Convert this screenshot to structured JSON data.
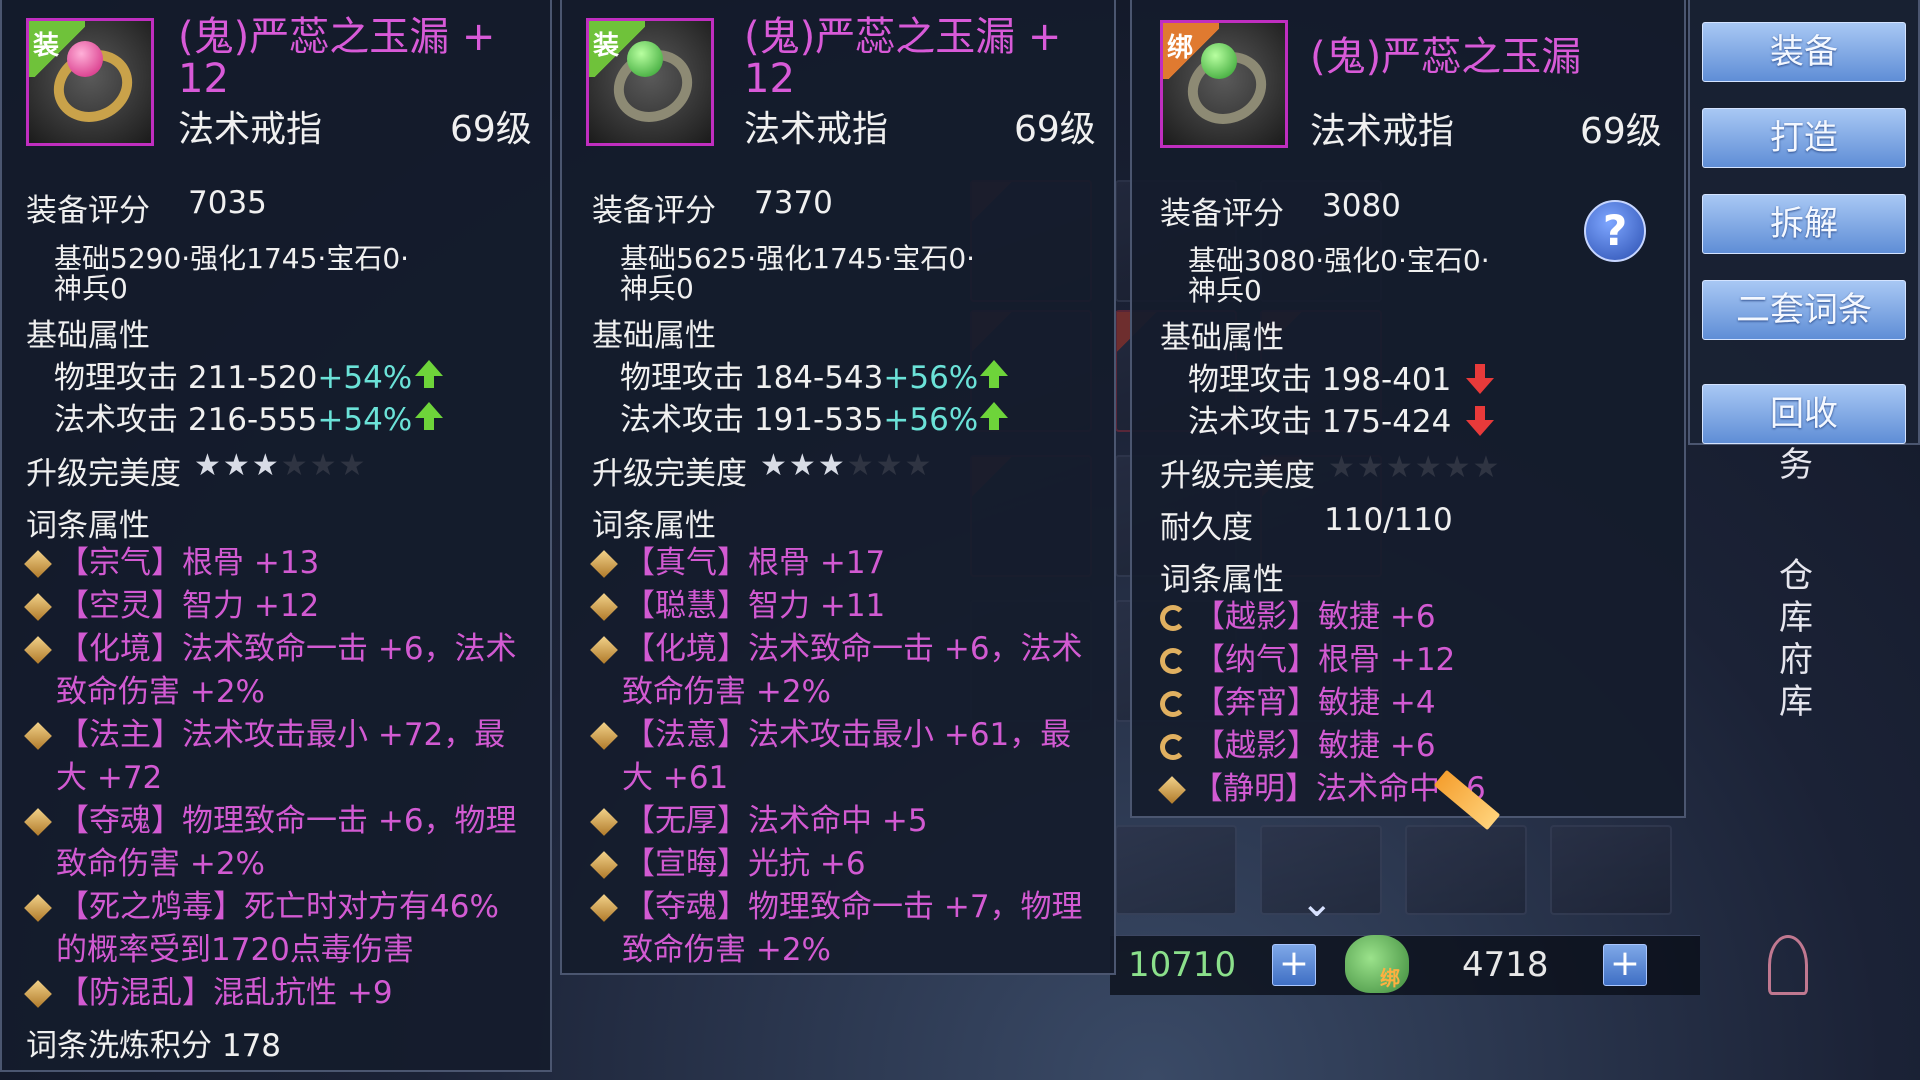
{
  "panels": [
    {
      "tag": "装",
      "name_line1": "(鬼)严蕊之玉漏 +",
      "name_line2": "12",
      "type": "法术戒指",
      "level": "69级",
      "score_label": "装备评分",
      "score": "7035",
      "breakdown_line1": "基础5290·强化1745·宝石0·",
      "breakdown_line2": "神兵0",
      "base_attr_label": "基础属性",
      "attrs": [
        {
          "name": "物理攻击 211-520",
          "pct": "+54%"
        },
        {
          "name": "法术攻击 216-555",
          "pct": "+54%"
        }
      ],
      "upgrade_label": "升级完美度",
      "stars_filled": 3,
      "stars_total": 6,
      "affix_label": "词条属性",
      "affixes": [
        {
          "line1": "【宗气】根骨 +13"
        },
        {
          "line1": "【空灵】智力 +12"
        },
        {
          "line1": "【化境】法术致命一击 +6，法术",
          "line2": "致命伤害 +2%"
        },
        {
          "line1": "【法主】法术攻击最小 +72，最",
          "line2": "大 +72"
        },
        {
          "line1": "【夺魂】物理致命一击 +6，物理",
          "line2": "致命伤害 +2%"
        },
        {
          "line1": "【死之鸩毒】死亡时对方有46%",
          "line2": "的概率受到1720点毒伤害"
        },
        {
          "line1": "【防混乱】混乱抗性 +9"
        }
      ],
      "footer": "词条洗炼积分 178"
    },
    {
      "tag": "装",
      "name_line1": "(鬼)严蕊之玉漏 +",
      "name_line2": "12",
      "type": "法术戒指",
      "level": "69级",
      "score_label": "装备评分",
      "score": "7370",
      "breakdown_line1": "基础5625·强化1745·宝石0·",
      "breakdown_line2": "神兵0",
      "base_attr_label": "基础属性",
      "attrs": [
        {
          "name": "物理攻击 184-543",
          "pct": "+56%"
        },
        {
          "name": "法术攻击 191-535",
          "pct": "+56%"
        }
      ],
      "upgrade_label": "升级完美度",
      "stars_filled": 3,
      "stars_total": 6,
      "affix_label": "词条属性",
      "affixes": [
        {
          "line1": "【真气】根骨 +17"
        },
        {
          "line1": "【聪慧】智力 +11"
        },
        {
          "line1": "【化境】法术致命一击 +6，法术",
          "line2": "致命伤害 +2%"
        },
        {
          "line1": "【法意】法术攻击最小 +61，最",
          "line2": "大 +61"
        },
        {
          "line1": "【无厚】法术命中 +5"
        },
        {
          "line1": "【宣晦】光抗 +6"
        },
        {
          "line1": "【夺魂】物理致命一击 +7，物理",
          "line2": "致命伤害 +2%"
        }
      ]
    },
    {
      "tag": "绑",
      "name_line1": "(鬼)严蕊之玉漏",
      "type": "法术戒指",
      "level": "69级",
      "score_label": "装备评分",
      "score": "3080",
      "breakdown_line1": "基础3080·强化0·宝石0·",
      "breakdown_line2": "神兵0",
      "base_attr_label": "基础属性",
      "attrs": [
        {
          "name": "物理攻击 198-401"
        },
        {
          "name": "法术攻击 175-424"
        }
      ],
      "upgrade_label": "升级完美度",
      "stars_filled": 0,
      "stars_total": 6,
      "durability_label": "耐久度",
      "durability": "110/110",
      "affix_label": "词条属性",
      "affixes": [
        {
          "line1": "【越影】敏捷 +6"
        },
        {
          "line1": "【纳气】根骨 +12"
        },
        {
          "line1": "【奔宵】敏捷 +4"
        },
        {
          "line1": "【越影】敏捷 +6"
        },
        {
          "line1": "【静明】法术命中+6"
        }
      ],
      "help": "?"
    }
  ],
  "menu": {
    "buttons": [
      "装备",
      "打造",
      "拆解",
      "二套词条",
      "回收"
    ],
    "side_text_1": "务",
    "side_text_2": [
      "仓",
      "库",
      "府",
      "库"
    ]
  },
  "currency": {
    "value1": "10710",
    "value2": "4718",
    "plus": "+",
    "bag_tag": "绑"
  },
  "colors": {
    "item_name": "#d85ad8",
    "affix": "#d25ad2",
    "percent": "#6be2d8",
    "up_arrow": "#6ed43a",
    "down_arrow": "#e83a3a",
    "rarity_border": "#c02ec0",
    "button": "#6f9ae0"
  }
}
